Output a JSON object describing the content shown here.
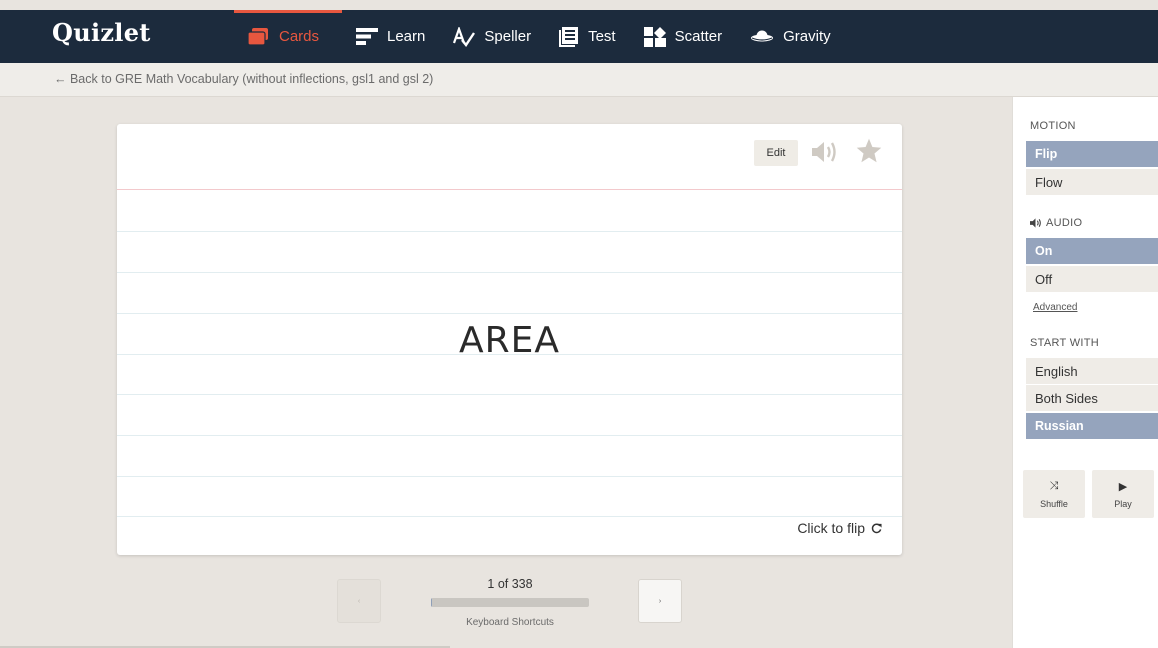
{
  "app": {
    "logo": "Quizlet"
  },
  "nav": {
    "items": [
      {
        "label": "Cards",
        "icon": "cards-icon",
        "active": true
      },
      {
        "label": "Learn",
        "icon": "learn-icon"
      },
      {
        "label": "Speller",
        "icon": "speller-icon"
      },
      {
        "label": "Test",
        "icon": "test-icon"
      },
      {
        "label": "Scatter",
        "icon": "scatter-icon"
      },
      {
        "label": "Gravity",
        "icon": "gravity-icon"
      }
    ]
  },
  "subbar": {
    "back_link": "← Back to GRE Math Vocabulary (without inflections, gsl1 and gsl 2)"
  },
  "card": {
    "edit_label": "Edit",
    "term": "AREA",
    "flip_hint": "Click to flip"
  },
  "pager": {
    "counter": "1 of 338",
    "progress": 0.003,
    "shortcuts": "Keyboard Shortcuts",
    "prev_glyph": "‹",
    "next_glyph": "›"
  },
  "sidebar": {
    "motion": {
      "heading": "MOTION",
      "options": [
        "Flip",
        "Flow"
      ],
      "selected": "Flip"
    },
    "audio": {
      "heading": "AUDIO",
      "options": [
        "On",
        "Off"
      ],
      "selected": "On",
      "advanced_link": "Advanced"
    },
    "start_with": {
      "heading": "START WITH",
      "options": [
        "English",
        "Both Sides",
        "Russian"
      ],
      "selected": "Russian"
    },
    "shuffle_label": "Shuffle",
    "shuffle_glyph": "⤨",
    "play_label": "Play",
    "play_glyph": "▶"
  },
  "colors": {
    "topbar": "#1c2b3d",
    "accent": "#e7573f",
    "selected_option": "#95a4bd",
    "background": "#e8e4df"
  }
}
